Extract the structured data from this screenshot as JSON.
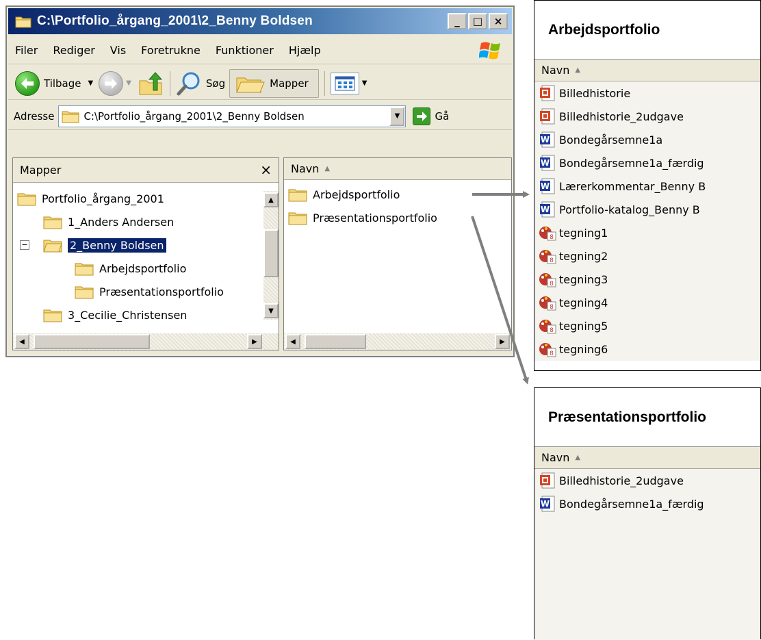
{
  "window": {
    "title": "C:\\Portfolio_årgang_2001\\2_Benny Boldsen",
    "buttons": {
      "minimize": "_",
      "maximize": "□",
      "close": "×"
    }
  },
  "menu": [
    "Filer",
    "Rediger",
    "Vis",
    "Foretrukne",
    "Funktioner",
    "Hjælp"
  ],
  "toolbar": {
    "back": "Tilbage",
    "search": "Søg",
    "folders": "Mapper"
  },
  "address": {
    "label": "Adresse",
    "value": "C:\\Portfolio_årgang_2001\\2_Benny Boldsen",
    "go": "Gå"
  },
  "folders_pane": {
    "title": "Mapper",
    "close": "×",
    "tree": [
      {
        "label": "Portfolio_årgang_2001"
      },
      {
        "label": "1_Anders Andersen"
      },
      {
        "label": "2_Benny Boldsen",
        "expander": "−"
      },
      {
        "label": "Arbejdsportfolio"
      },
      {
        "label": "Præsentationsportfolio"
      },
      {
        "label": "3_Cecilie_Christensen"
      }
    ]
  },
  "files_pane": {
    "column": "Navn",
    "items": [
      "Arbejdsportfolio",
      "Præsentationsportfolio"
    ]
  },
  "panel_arbejd": {
    "title": "Arbejdsportfolio",
    "column": "Navn",
    "items": [
      {
        "name": "Billedhistorie",
        "icon": "powerpoint-icon"
      },
      {
        "name": "Billedhistorie_2udgave",
        "icon": "powerpoint-icon"
      },
      {
        "name": "Bondegårsemne1a",
        "icon": "word-icon"
      },
      {
        "name": "Bondegårsemne1a_færdig",
        "icon": "word-icon"
      },
      {
        "name": "Lærerkommentar_Benny B",
        "icon": "word-icon"
      },
      {
        "name": "Portfolio-katalog_Benny B",
        "icon": "word-icon"
      },
      {
        "name": "tegning1",
        "icon": "paint-icon"
      },
      {
        "name": "tegning2",
        "icon": "paint-icon"
      },
      {
        "name": "tegning3",
        "icon": "paint-icon"
      },
      {
        "name": "tegning4",
        "icon": "paint-icon"
      },
      {
        "name": "tegning5",
        "icon": "paint-icon"
      },
      {
        "name": "tegning6",
        "icon": "paint-icon"
      }
    ]
  },
  "panel_praes": {
    "title": "Præsentationsportfolio",
    "column": "Navn",
    "items": [
      {
        "name": "Billedhistorie_2udgave",
        "icon": "powerpoint-icon"
      },
      {
        "name": "Bondegårsemne1a_færdig",
        "icon": "word-icon"
      }
    ]
  },
  "colors": {
    "title_gradient_start": "#0a246a",
    "selection": "#0a246a",
    "arrow": "#7f7f7f"
  }
}
